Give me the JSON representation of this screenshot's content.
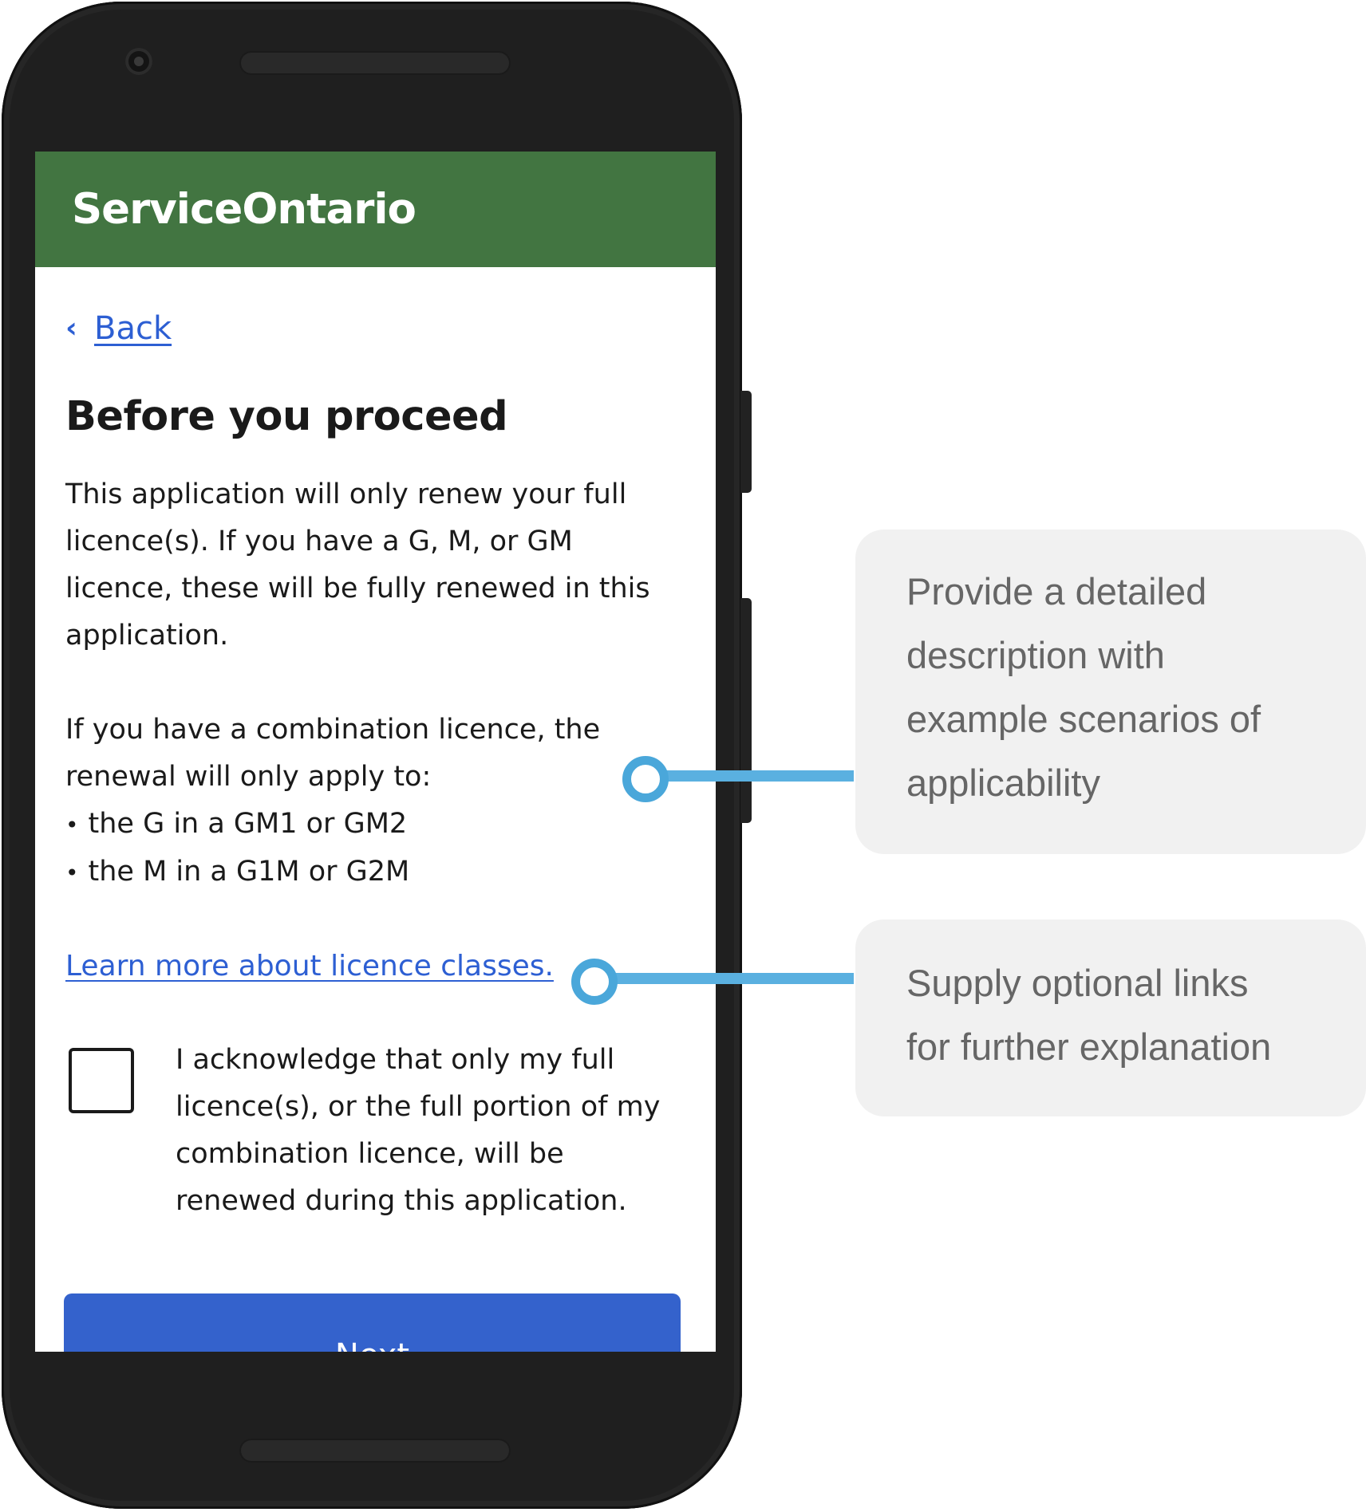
{
  "app": {
    "brand": "ServiceOntario"
  },
  "nav": {
    "back_label": "Back"
  },
  "page": {
    "title": "Before you proceed",
    "paragraph1": "This application will only renew your full licence(s). If you have a G, M, or GM licence, these will be fully renewed in this application.",
    "paragraph2": "If you have a combination licence, the renewal will only apply to:",
    "bullets": [
      "the G in a GM1 or GM2",
      "the M in a G1M or G2M"
    ],
    "learn_more_link": "Learn more about licence classes.",
    "acknowledgement": "I acknowledge that only my full licence(s), or the full portion of my combination licence, will be renewed during this application.",
    "checkbox_checked": false,
    "next_label": "Next"
  },
  "annotations": {
    "description_note": [
      "Provide a detailed",
      "description with",
      "example scenarios of",
      "applicability"
    ],
    "links_note": [
      "Supply optional links",
      "for further explanation"
    ]
  },
  "colors": {
    "header_green": "#427541",
    "link_blue": "#2d5fd3",
    "button_blue": "#3462cc",
    "callout_blue": "#5ab0e0",
    "note_background": "#f1f1f1"
  },
  "icons": {
    "back": "chevron-left-icon"
  }
}
